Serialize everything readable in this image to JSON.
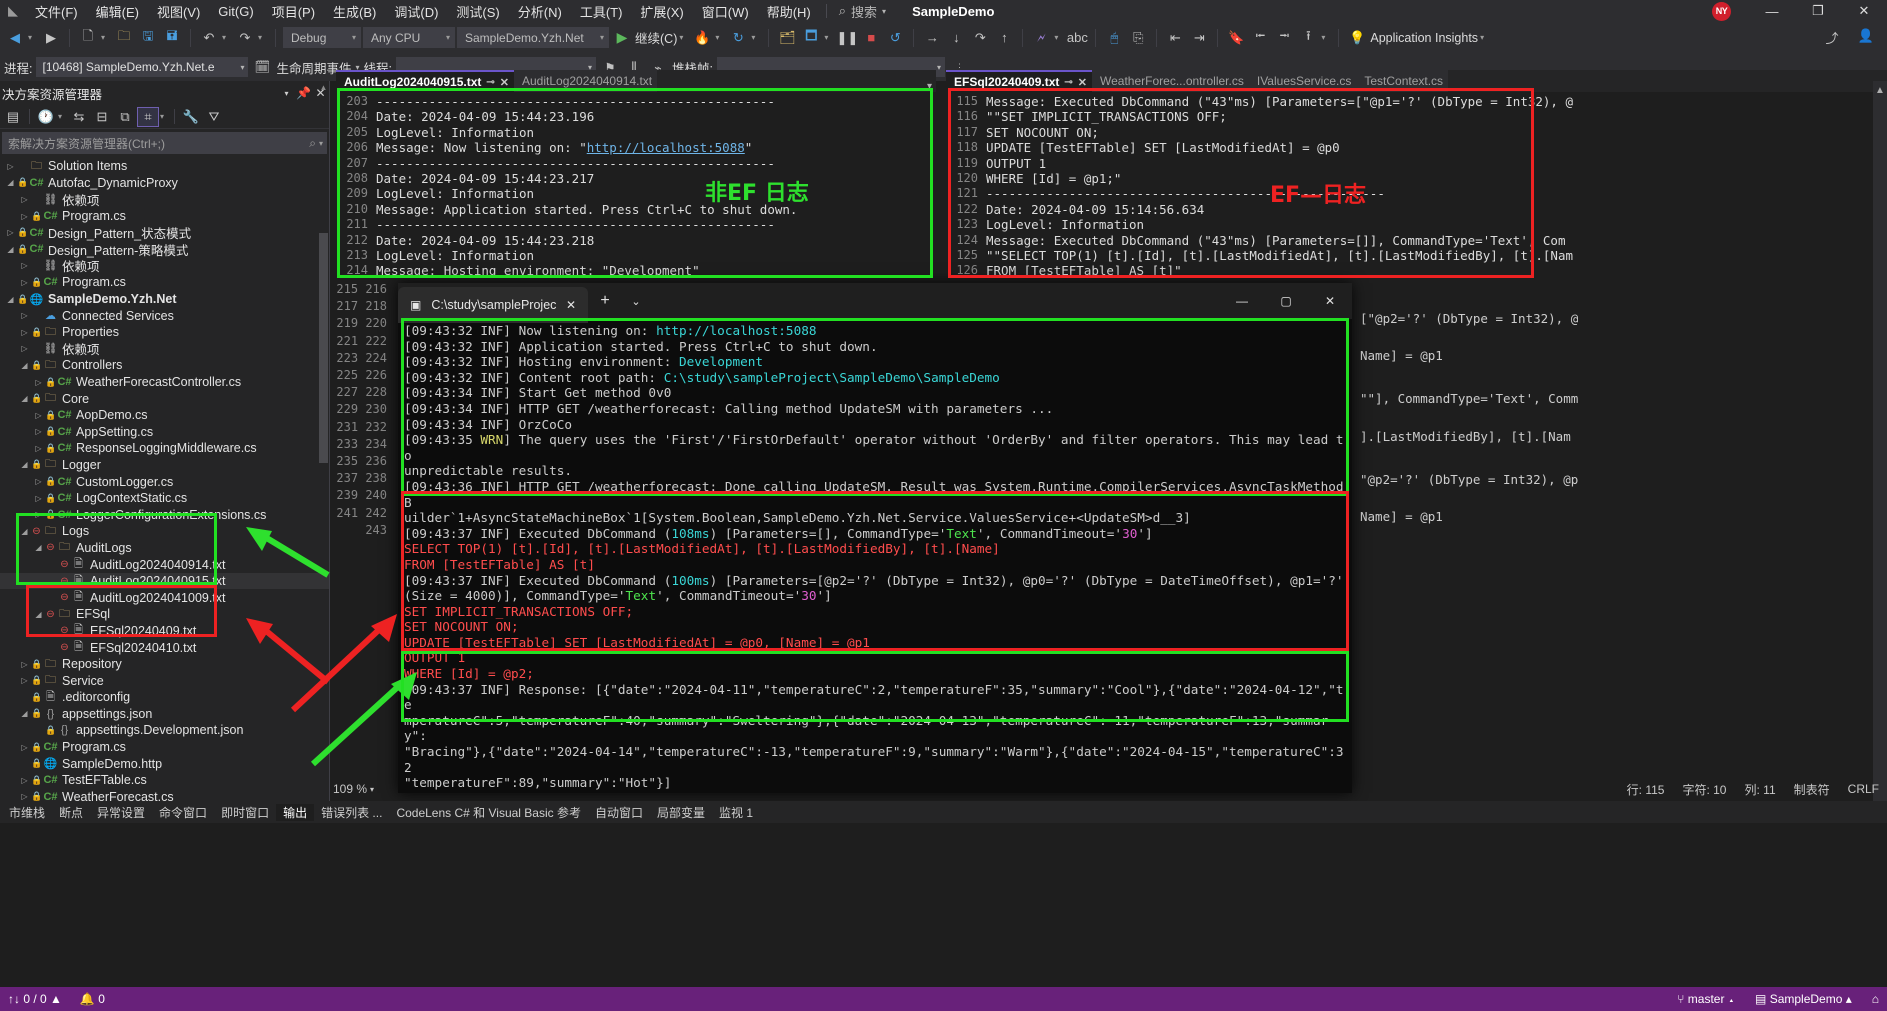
{
  "menubar": {
    "items": [
      "文件(F)",
      "编辑(E)",
      "视图(V)",
      "Git(G)",
      "项目(P)",
      "生成(B)",
      "调试(D)",
      "测试(S)",
      "分析(N)",
      "工具(T)",
      "扩展(X)",
      "窗口(W)",
      "帮助(H)"
    ],
    "search_label": "搜索",
    "app_title": "SampleDemo",
    "notification_badge": "NY",
    "minimize": "—",
    "maximize": "❐",
    "close": "✕"
  },
  "toolbar": {
    "config": "Debug",
    "platform": "Any CPU",
    "startup_project": "SampleDemo.Yzh.Net",
    "continue_label": "继续(C)",
    "app_insights_label": "Application Insights"
  },
  "debugbar": {
    "process_label": "进程:",
    "process_value": "[10468] SampleDemo.Yzh.Net.e",
    "lifecycle_label": "生命周期事件",
    "thread_label": "线程:",
    "thread_value": "",
    "stackframe_label": "堆栈帧:",
    "stackframe_value": ""
  },
  "solution_explorer": {
    "title": "决方案资源管理器",
    "search_placeholder": "索解决方案资源管理器(Ctrl+;)",
    "tree": [
      {
        "depth": 0,
        "exp": "▷",
        "icon": "folder",
        "label": "Solution Items",
        "lock": false
      },
      {
        "depth": 0,
        "exp": "◢",
        "icon": "cs-proj",
        "label": "Autofac_DynamicProxy",
        "lock": true
      },
      {
        "depth": 1,
        "exp": "▷",
        "icon": "dep",
        "label": "依赖项",
        "lock": false
      },
      {
        "depth": 1,
        "exp": "▷",
        "icon": "cs",
        "label": "Program.cs",
        "lock": true
      },
      {
        "depth": 0,
        "exp": "▷",
        "icon": "cs-proj",
        "label": "Design_Pattern_状态模式",
        "lock": true
      },
      {
        "depth": 0,
        "exp": "◢",
        "icon": "cs-proj",
        "label": "Design_Pattern-策略模式",
        "lock": true
      },
      {
        "depth": 1,
        "exp": "▷",
        "icon": "dep",
        "label": "依赖项",
        "lock": false
      },
      {
        "depth": 1,
        "exp": "▷",
        "icon": "cs",
        "label": "Program.cs",
        "lock": true
      },
      {
        "depth": 0,
        "exp": "◢",
        "icon": "web",
        "label": "SampleDemo.Yzh.Net",
        "lock": true,
        "bold": true
      },
      {
        "depth": 1,
        "exp": "▷",
        "icon": "connected",
        "label": "Connected Services",
        "lock": false
      },
      {
        "depth": 1,
        "exp": "▷",
        "icon": "props",
        "label": "Properties",
        "lock": true
      },
      {
        "depth": 1,
        "exp": "▷",
        "icon": "dep",
        "label": "依赖项",
        "lock": false
      },
      {
        "depth": 1,
        "exp": "◢",
        "icon": "folder",
        "label": "Controllers",
        "lock": true
      },
      {
        "depth": 2,
        "exp": "▷",
        "icon": "cs",
        "label": "WeatherForecastController.cs",
        "lock": true
      },
      {
        "depth": 1,
        "exp": "◢",
        "icon": "folder",
        "label": "Core",
        "lock": true
      },
      {
        "depth": 2,
        "exp": "▷",
        "icon": "cs",
        "label": "AopDemo.cs",
        "lock": true
      },
      {
        "depth": 2,
        "exp": "▷",
        "icon": "cs",
        "label": "AppSetting.cs",
        "lock": true
      },
      {
        "depth": 2,
        "exp": "▷",
        "icon": "cs",
        "label": "ResponseLoggingMiddleware.cs",
        "lock": true
      },
      {
        "depth": 1,
        "exp": "◢",
        "icon": "folder",
        "label": "Logger",
        "lock": true
      },
      {
        "depth": 2,
        "exp": "▷",
        "icon": "cs",
        "label": "CustomLogger.cs",
        "lock": true
      },
      {
        "depth": 2,
        "exp": "▷",
        "icon": "cs",
        "label": "LogContextStatic.cs",
        "lock": true
      },
      {
        "depth": 2,
        "exp": "▷",
        "icon": "cs",
        "label": "LoggerConfigurationExtensions.cs",
        "lock": true
      },
      {
        "depth": 1,
        "exp": "◢",
        "icon": "folder",
        "label": "Logs",
        "err": true
      },
      {
        "depth": 2,
        "exp": "◢",
        "icon": "folder",
        "label": "AuditLogs",
        "err": true
      },
      {
        "depth": 3,
        "exp": "",
        "icon": "doc",
        "label": "AuditLog2024040914.txt",
        "err": true
      },
      {
        "depth": 3,
        "exp": "",
        "icon": "doc",
        "label": "AuditLog2024040915.txt",
        "err": true,
        "selected": true
      },
      {
        "depth": 3,
        "exp": "",
        "icon": "doc",
        "label": "AuditLog2024041009.txt",
        "err": true
      },
      {
        "depth": 2,
        "exp": "◢",
        "icon": "folder",
        "label": "EFSql",
        "err": true
      },
      {
        "depth": 3,
        "exp": "",
        "icon": "doc",
        "label": "EFSql20240409.txt",
        "err": true
      },
      {
        "depth": 3,
        "exp": "",
        "icon": "doc",
        "label": "EFSql20240410.txt",
        "err": true
      },
      {
        "depth": 1,
        "exp": "▷",
        "icon": "folder",
        "label": "Repository",
        "lock": true
      },
      {
        "depth": 1,
        "exp": "▷",
        "icon": "folder",
        "label": "Service",
        "lock": true
      },
      {
        "depth": 1,
        "exp": "",
        "icon": "editorconfig",
        "label": ".editorconfig",
        "lock": true
      },
      {
        "depth": 1,
        "exp": "◢",
        "icon": "json",
        "label": "appsettings.json",
        "lock": true
      },
      {
        "depth": 2,
        "exp": "",
        "icon": "json",
        "label": "appsettings.Development.json",
        "lock": true
      },
      {
        "depth": 1,
        "exp": "▷",
        "icon": "cs",
        "label": "Program.cs",
        "lock": true
      },
      {
        "depth": 1,
        "exp": "",
        "icon": "http",
        "label": "SampleDemo.http",
        "lock": true
      },
      {
        "depth": 1,
        "exp": "▷",
        "icon": "cs",
        "label": "TestEFTable.cs",
        "lock": true
      },
      {
        "depth": 1,
        "exp": "▷",
        "icon": "cs",
        "label": "WeatherForecast.cs",
        "lock": true
      }
    ]
  },
  "editor_left": {
    "tabs": [
      {
        "label": "AuditLog2024040915.txt",
        "active": true
      },
      {
        "label": "AuditLog2024040914.txt",
        "active": false
      }
    ],
    "lines": [
      {
        "num": "203",
        "text": "-----------------------------------------------------"
      },
      {
        "num": "204",
        "text": "Date: 2024-04-09 15:44:23.196"
      },
      {
        "num": "205",
        "text": "LogLevel: Information"
      },
      {
        "num": "206",
        "text": "Message: Now listening on: \"http://localhost:5088\"",
        "link": "http://localhost:5088"
      },
      {
        "num": "207",
        "text": "-----------------------------------------------------"
      },
      {
        "num": "208",
        "text": "Date: 2024-04-09 15:44:23.217"
      },
      {
        "num": "209",
        "text": "LogLevel: Information"
      },
      {
        "num": "210",
        "text": "Message: Application started. Press Ctrl+C to shut down."
      },
      {
        "num": "211",
        "text": "-----------------------------------------------------"
      },
      {
        "num": "212",
        "text": "Date: 2024-04-09 15:44:23.218"
      },
      {
        "num": "213",
        "text": "LogLevel: Information"
      },
      {
        "num": "214",
        "text": "Message: Hosting environment: \"Development\""
      }
    ],
    "annotation": "非EF 日志"
  },
  "editor_right": {
    "tabs": [
      {
        "label": "EFSql20240409.txt",
        "active": true
      },
      {
        "label": "WeatherForec...ontroller.cs",
        "active": false
      },
      {
        "label": "IValuesService.cs",
        "active": false
      },
      {
        "label": "TestContext.cs",
        "active": false
      }
    ],
    "lines": [
      {
        "num": "115",
        "text": "Message: Executed DbCommand (\"43\"ms) [Parameters=[\"@p1='?' (DbType = Int32), @"
      },
      {
        "num": "116",
        "text": "\"\"SET IMPLICIT_TRANSACTIONS OFF;"
      },
      {
        "num": "117",
        "text": "SET NOCOUNT ON;"
      },
      {
        "num": "118",
        "text": "UPDATE [TestEFTable] SET [LastModifiedAt] = @p0"
      },
      {
        "num": "119",
        "text": "OUTPUT 1"
      },
      {
        "num": "120",
        "text": "WHERE [Id] = @p1;\""
      },
      {
        "num": "121",
        "text": "-----------------------------------------------------"
      },
      {
        "num": "122",
        "text": "Date: 2024-04-09 15:14:56.634"
      },
      {
        "num": "123",
        "text": "LogLevel: Information"
      },
      {
        "num": "124",
        "text": "Message: Executed DbCommand (\"43\"ms) [Parameters=[]], CommandType='Text', Com"
      },
      {
        "num": "125",
        "text": "\"\"SELECT TOP(1) [t].[Id], [t].[LastModifiedAt], [t].[LastModifiedBy], [t].[Nam"
      },
      {
        "num": "126",
        "text": "FROM [TestEFTable] AS [t]\""
      }
    ],
    "annotation": "EF—日志"
  },
  "editor_background_right": [
    {
      "text": "[\"@p2='?' (DbType = Int32), @"
    },
    {
      "text": "Name] = @p1"
    },
    {
      "text": "\"\"], CommandType='Text', Comm"
    },
    {
      "text": "].[LastModifiedBy], [t].[Nam"
    },
    {
      "text": "\"@p2='?' (DbType = Int32), @p"
    },
    {
      "text": "Name] = @p1"
    }
  ],
  "console": {
    "tab_title": "C:\\study\\sampleProject\\Sampl",
    "close_icon": "✕",
    "new_tab_icon": "+",
    "dropdown_icon": "⌄",
    "minimize": "—",
    "maximize": "▢",
    "close": "✕",
    "lines": [
      "[09:43:32 INF] Now listening on: http://localhost:5088",
      "[09:43:32 INF] Application started. Press Ctrl+C to shut down.",
      "[09:43:32 INF] Hosting environment: Development",
      "[09:43:32 INF] Content root path: C:\\study\\sampleProject\\SampleDemo\\SampleDemo",
      "[09:43:34 INF] Start Get method 0v0",
      "[09:43:34 INF] HTTP GET /weatherforecast: Calling method UpdateSM with parameters ...",
      "[09:43:34 INF] OrzCoCo",
      "[09:43:35 WRN] The query uses the 'First'/'FirstOrDefault' operator without 'OrderBy' and filter operators. This may lead to",
      "unpredictable results.",
      "[09:43:36 INF] HTTP GET /weatherforecast: Done calling UpdateSM. Result was System.Runtime.CompilerServices.AsyncTaskMethodB",
      "uilder`1+AsyncStateMachineBox`1[System.Boolean,SampleDemo.Yzh.Net.Service.ValuesService+<UpdateSM>d__3]",
      "[09:43:37 INF] Executed DbCommand (108ms) [Parameters=[], CommandType='Text', CommandTimeout='30']",
      "SELECT TOP(1) [t].[Id], [t].[LastModifiedAt], [t].[LastModifiedBy], [t].[Name]",
      "FROM [TestEFTable] AS [t]",
      "[09:43:37 INF] Executed DbCommand (100ms) [Parameters=[@p2='?' (DbType = Int32), @p0='?' (DbType = DateTimeOffset), @p1='?'",
      "(Size = 4000)], CommandType='Text', CommandTimeout='30']",
      "SET IMPLICIT_TRANSACTIONS OFF;",
      "SET NOCOUNT ON;",
      "UPDATE [TestEFTable] SET [LastModifiedAt] = @p0, [Name] = @p1",
      "OUTPUT 1",
      "WHERE [Id] = @p2;",
      "[09:43:37 INF] Response: [{\"date\":\"2024-04-11\",\"temperatureC\":2,\"temperatureF\":35,\"summary\":\"Cool\"},{\"date\":\"2024-04-12\",\"te",
      "mperatureC\":5,\"temperatureF\":40,\"summary\":\"Sweltering\"},{\"date\":\"2024-04-13\",\"temperatureC\":-11,\"temperatureF\":13,\"summary\":",
      "\"Bracing\"},{\"date\":\"2024-04-14\",\"temperatureC\":-13,\"temperatureF\":9,\"summary\":\"Warm\"},{\"date\":\"2024-04-15\",\"temperatureC\":32",
      "\"temperatureF\":89,\"summary\":\"Hot\"}]"
    ]
  },
  "editor_line_numbers_behind": [
    "215",
    "216",
    "217",
    "218",
    "219",
    "220",
    "221",
    "222",
    "223",
    "224",
    "225",
    "226",
    "227",
    "228",
    "229",
    "230",
    "231",
    "232",
    "233",
    "234",
    "235",
    "236",
    "237",
    "238",
    "239",
    "240",
    "241",
    "242",
    "243"
  ],
  "zoom_control": {
    "value": "109 %"
  },
  "editor_status": {
    "line_label": "行: 115",
    "char_label": "字符: 10",
    "col_label": "列: 11",
    "tabs_label": "制表符",
    "eol_label": "CRLF"
  },
  "bottom_tabs": [
    "市维栈",
    "断点",
    "异常设置",
    "命令窗口",
    "即时窗口",
    "输出",
    "错误列表 ...",
    "CodeLens C# 和 Visual Basic 参考",
    "自动窗口",
    "局部变量",
    "监视 1"
  ],
  "footer": {
    "errors": "0",
    "warnings": "0",
    "messages": "0",
    "issues_label": "↑↓ 0 / 0 ▲",
    "bell": "0",
    "branch": "master",
    "repo": "SampleDemo"
  }
}
